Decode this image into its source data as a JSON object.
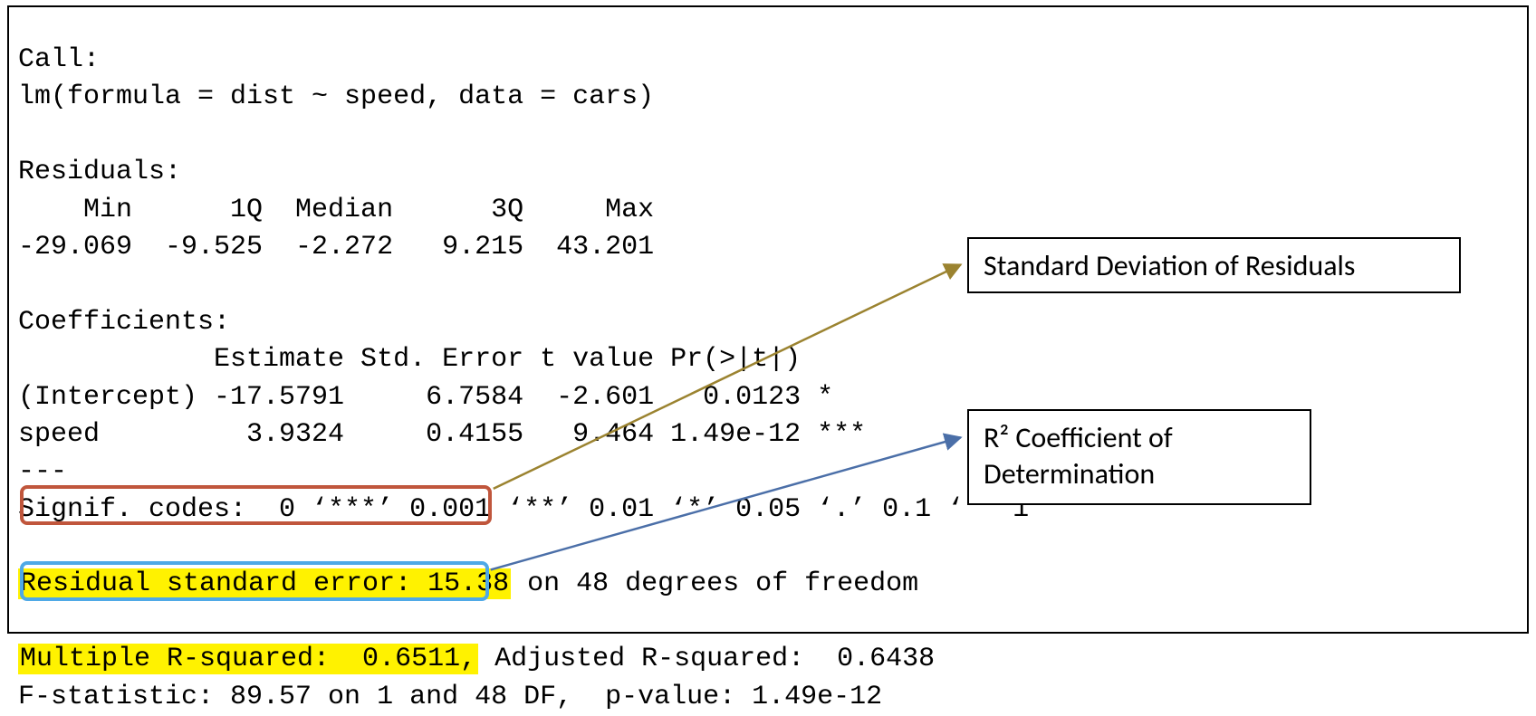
{
  "call_label": "Call:",
  "call_formula": "lm(formula = dist ~ speed, data = cars)",
  "residuals_label": "Residuals:",
  "residuals_header": "    Min      1Q  Median      3Q     Max ",
  "residuals_values": "-29.069  -9.525  -2.272   9.215  43.201 ",
  "coef_label": "Coefficients:",
  "coef_header": "            Estimate Std. Error t value Pr(>|t|)    ",
  "coef_intercept": "(Intercept) -17.5791     6.7584  -2.601   0.0123 *  ",
  "coef_speed": "speed         3.9324     0.4155   9.464 1.49e-12 ***",
  "sep": "---",
  "signif": "Signif. codes:  0 ‘***’ 0.001 ‘**’ 0.01 ‘*’ 0.05 ‘.’ 0.1 ‘ ’ 1",
  "rse_hl": "Residual standard error: 15.38",
  "rse_rest": " on 48 degrees of freedom",
  "r2_hl": "Multiple R-squared:  0.6511,",
  "r2_rest": " Adjusted R-squared:  0.6438 ",
  "fstat": "F-statistic: 89.57 on 1 and 48 DF,  p-value: 1.49e-12",
  "annot1": "Standard Deviation of Residuals",
  "annot2": "R² Coefficient of Determination",
  "colors": {
    "rse_box": "#c0563c",
    "r2_box": "#4fa9e6",
    "highlight": "#fff200",
    "arrow1": "#9b8330",
    "arrow2": "#4b6fa8"
  }
}
